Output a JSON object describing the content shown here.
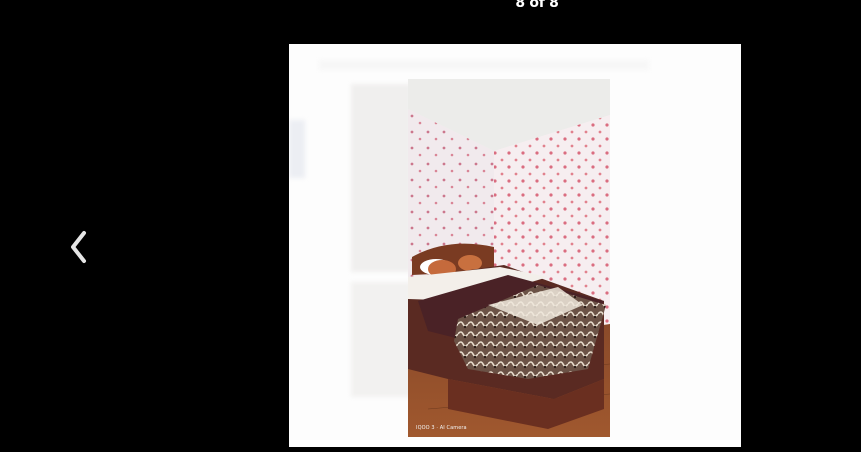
{
  "viewer": {
    "counter_text": "8 of 8",
    "current": 8,
    "total": 8
  },
  "navigation": {
    "prev_icon": "chevron-left-icon"
  },
  "photo": {
    "subject": "bedroom-photo",
    "watermark": "IQOO 3 · AI Camera"
  },
  "colors": {
    "background": "#000000",
    "frame": "#fdfdfd",
    "chevron": "#e6e6e6"
  }
}
